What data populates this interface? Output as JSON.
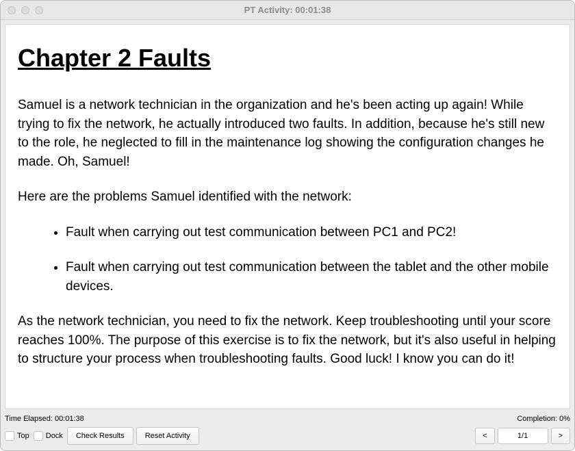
{
  "window": {
    "title": "PT Activity: 00:01:38"
  },
  "content": {
    "heading": "Chapter 2 Faults",
    "para1": "Samuel is a network technician in the organization and he's been acting up again! While trying to fix the network, he actually introduced two faults. In addition, because he's still new to the role, he neglected to fill in the maintenance log showing the configuration changes he made. Oh, Samuel!",
    "para2": "Here are the problems Samuel identified with the network:",
    "faults": [
      "Fault when carrying out test communication between PC1 and PC2!",
      "Fault when carrying out test communication between the tablet and the other mobile devices."
    ],
    "para3": "As the network technician, you need to fix the network. Keep troubleshooting until your score reaches 100%. The purpose of this exercise is to fix the network, but it's also useful in helping to structure your process when troubleshooting faults. Good luck! I know you can do it!"
  },
  "status": {
    "time_elapsed": "Time Elapsed: 00:01:38",
    "completion": "Completion: 0%"
  },
  "bottombar": {
    "top_label": "Top",
    "dock_label": "Dock",
    "check_results": "Check Results",
    "reset_activity": "Reset Activity",
    "prev": "<",
    "page": "1/1",
    "next": ">"
  }
}
